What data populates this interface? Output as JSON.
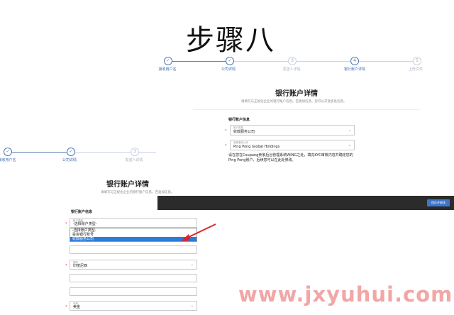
{
  "heading": "步骤八",
  "steps": [
    "接收用户名",
    "公司详情",
    "发送人详情",
    "银行账户详情",
    "上传文件"
  ],
  "top_panel": {
    "title": "银行账户详情",
    "subtitle": "请填写与正规化企业的银行账户信息。百奥加信息。您可以开放多处信息。",
    "section": "银行账户信息",
    "account_type": {
      "label": "账户类型",
      "value": "收款服务公司"
    },
    "bank": {
      "label": "收款服务公司",
      "value": "Ping Pong Global Holdings"
    },
    "notice": "请在您在Coupang卖家后台管理系统WING之处，填充KYC审核内容并确定您的Ping Pong账户，后续您可以在此处修改。"
  },
  "bottom_panel": {
    "title": "银行账户详情",
    "subtitle": "请填写与正规化企业的银行账户信息。百奥加信息。",
    "section": "银行账户信息",
    "account_type": {
      "label": "账户类型",
      "value": "-选择账户类型-"
    },
    "dropdown_options": [
      "-选择账户类型-",
      "投资银行账号",
      "收款服务公司"
    ],
    "selected_option": 2,
    "field_country": {
      "label": "国家",
      "value": "印度尼西"
    },
    "field_currency": {
      "label": "币种",
      "value": "美金"
    }
  },
  "next_button": "保存并继续",
  "watermark": "www.jxyuhui.com",
  "colors": {
    "accent": "#3e76c8",
    "arrow": "#d9262c",
    "watermark": "#f2a6a6",
    "bar": "#2b2b2b"
  }
}
